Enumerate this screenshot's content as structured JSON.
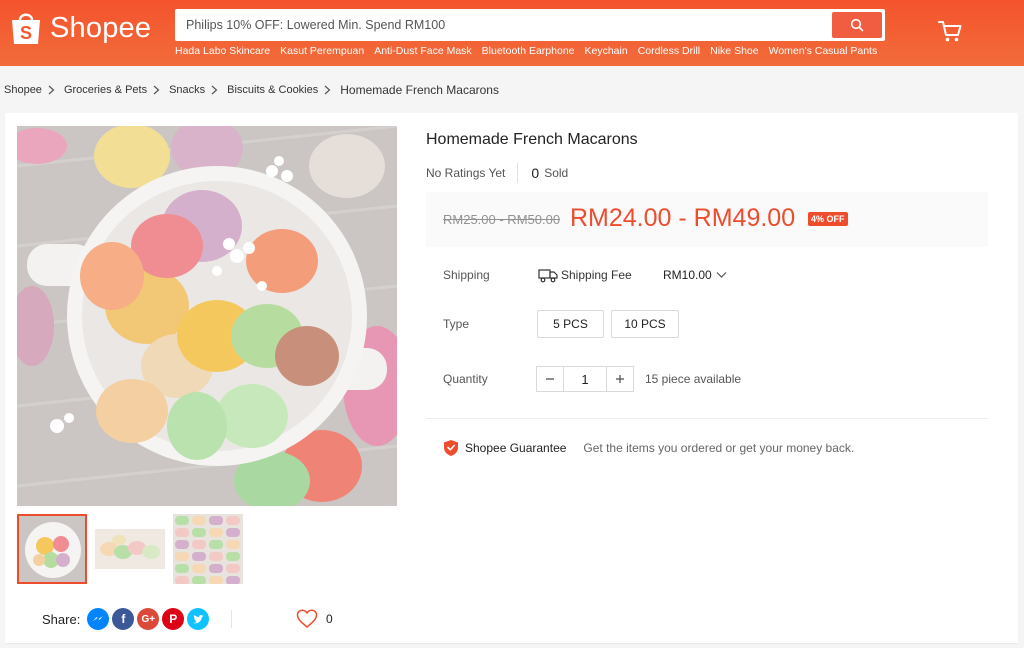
{
  "colors": {
    "brand": "#ee4d2d",
    "header": "#f1582d"
  },
  "header": {
    "logo_text": "Shopee",
    "search_placeholder": "Philips 10% OFF: Lowered Min. Spend RM100",
    "hints": [
      "Hada Labo Skincare",
      "Kasut Perempuan",
      "Anti-Dust Face Mask",
      "Bluetooth Earphone",
      "Keychain",
      "Cordless Drill",
      "Nike Shoe",
      "Women's Casual Pants"
    ]
  },
  "breadcrumb": [
    "Shopee",
    "Groceries & Pets",
    "Snacks",
    "Biscuits & Cookies",
    "Homemade French Macarons"
  ],
  "product": {
    "title": "Homemade French Macarons",
    "ratings": "No Ratings Yet",
    "sold_count": "0",
    "sold_label": "Sold",
    "old_price": "RM25.00 - RM50.00",
    "price": "RM24.00 - RM49.00",
    "discount": "4% OFF",
    "shipping_label": "Shipping",
    "shipping_fee_label": "Shipping Fee",
    "shipping_fee": "RM10.00",
    "type_label": "Type",
    "variants": [
      "5 PCS",
      "10 PCS"
    ],
    "quantity_label": "Quantity",
    "quantity": "1",
    "available": "15 piece available",
    "guarantee_title": "Shopee Guarantee",
    "guarantee_text": "Get the items you ordered or get your money back."
  },
  "share": {
    "label": "Share:",
    "like_count": "0"
  }
}
